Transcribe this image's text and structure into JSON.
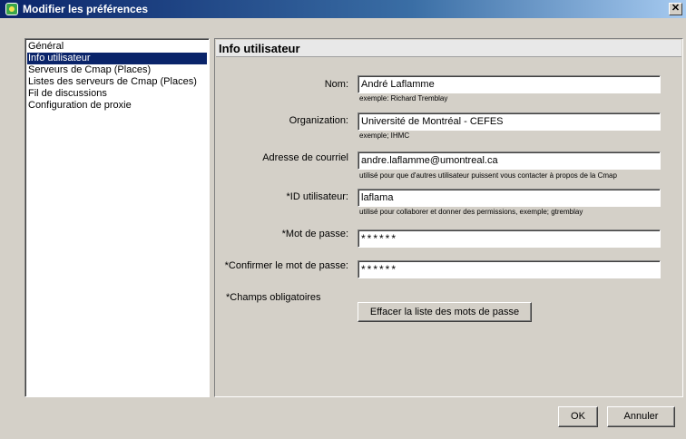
{
  "window": {
    "title": "Modifier les préférences",
    "close_label": "✕"
  },
  "sidebar": {
    "items": [
      {
        "label": "Général"
      },
      {
        "label": "Info utilisateur"
      },
      {
        "label": "Serveurs de Cmap (Places)"
      },
      {
        "label": "Listes des serveurs de Cmap (Places)"
      },
      {
        "label": "Fil de discussions"
      },
      {
        "label": "Configuration de proxie"
      }
    ],
    "selected": "Info utilisateur"
  },
  "panel": {
    "title": "Info utilisateur",
    "fields": {
      "nom": {
        "label": "Nom:",
        "value": "André Laflamme",
        "hint": "exemple: Richard Tremblay"
      },
      "organization": {
        "label": "Organization:",
        "value": "Université de Montréal - CEFES",
        "hint": "exemple; IHMC"
      },
      "courriel": {
        "label": "Adresse de courriel",
        "value": "andre.laflamme@umontreal.ca",
        "hint": "utilisé pour que d'autres utilisateur puissent vous contacter à propos de la Cmap"
      },
      "id": {
        "label": "*ID utilisateur:",
        "value": "laflama",
        "hint": "utilisé pour collaborer et donner des permissions, exemple; gtremblay"
      },
      "motdepasse": {
        "label": "*Mot de passe:",
        "value": "******"
      },
      "confirmer": {
        "label": "*Confirmer le mot de passe:",
        "value": "******"
      }
    },
    "required_note": "*Champs obligatoires",
    "clear_button": "Effacer la liste des mots de passe"
  },
  "footer": {
    "ok_label": "OK",
    "cancel_label": "Annuler"
  }
}
